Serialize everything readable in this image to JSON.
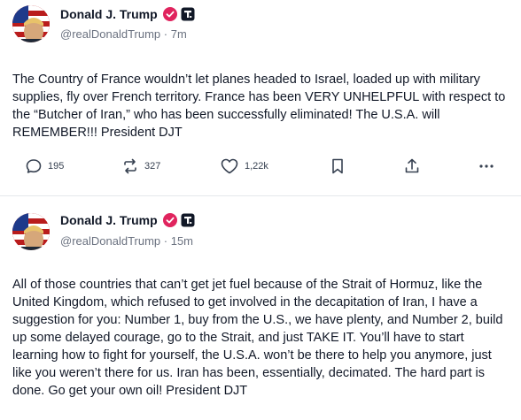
{
  "posts": [
    {
      "author": "Donald J. Trump",
      "handle": "@realDonaldTrump",
      "time": "7m",
      "text": "The Country of France wouldn’t let planes headed to Israel, loaded up with military supplies, fly over French territory. France has been VERY UNHELPFUL with respect to the “Butcher of Iran,” who has been successfully eliminated! The U.S.A. will REMEMBER!!! President DJT",
      "actions": {
        "replies": "195",
        "reposts": "327",
        "likes": "1,22k",
        "icons": [
          "reply-icon",
          "repost-icon",
          "like-icon",
          "bookmark-icon",
          "share-icon",
          "more-icon"
        ]
      }
    },
    {
      "author": "Donald J. Trump",
      "handle": "@realDonaldTrump",
      "time": "15m",
      "text": "All of those countries that can’t get jet fuel because of the Strait of Hormuz, like the United Kingdom, which refused to get involved in the decapitation of Iran, I have a suggestion for you: Number 1, buy from the U.S., we have plenty, and Number 2, build up some delayed courage, go to the Strait, and just TAKE IT. You’ll have to start learning how to fight for yourself, the U.S.A. won’t be there to help you anymore, just like you weren’t there for us. Iran has been, essentially, decimated. The hard part is done. Go get your own oil! President DJT"
    }
  ],
  "meta_separator": " · ",
  "colors": {
    "verified": "#e0245e",
    "muted": "#6b7280",
    "text": "#111827"
  }
}
